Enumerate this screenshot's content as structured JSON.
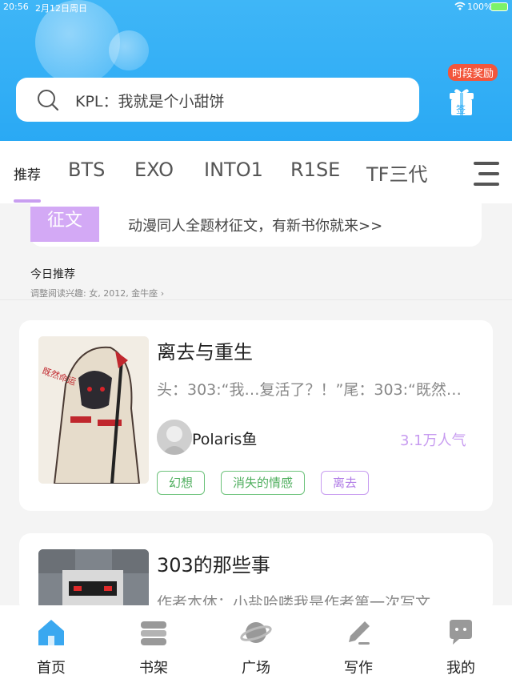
{
  "status_bar": {
    "time": "20:56",
    "date": "2月12日周日",
    "battery": "100%"
  },
  "search": {
    "placeholder": "KPL：我就是个小甜饼"
  },
  "reward": {
    "badge": "时段奖励",
    "box_label": "签"
  },
  "tabs": [
    {
      "label": "推荐",
      "active": true
    },
    {
      "label": "BTS"
    },
    {
      "label": "EXO"
    },
    {
      "label": "INTO1"
    },
    {
      "label": "R1SE"
    },
    {
      "label": "TF三代"
    }
  ],
  "banner": {
    "tag": "征文",
    "text": "动漫同人全题材征文，有新书你就来>>"
  },
  "recommendation": {
    "title": "今日推荐",
    "subtitle": "调整阅读兴趣: 女, 2012, 金牛座",
    "chevron": "›"
  },
  "books": [
    {
      "title": "离去与重生",
      "description": "头：303:“我…复活了？！”尾：303:“既然…",
      "author": "Polaris鱼",
      "popularity": "3.1万人气",
      "tags": [
        {
          "label": "幻想",
          "style": "green"
        },
        {
          "label": "消失的情感",
          "style": "green"
        },
        {
          "label": "离去",
          "style": "purple"
        }
      ]
    },
    {
      "title": "303的那些事",
      "description": "作者本体：小盐哈喽我是作者第一次写文…"
    }
  ],
  "bottom_nav": [
    {
      "label": "首页",
      "icon": "home-icon",
      "active": true
    },
    {
      "label": "书架",
      "icon": "bookshelf-icon"
    },
    {
      "label": "广场",
      "icon": "planet-icon"
    },
    {
      "label": "写作",
      "icon": "pen-icon"
    },
    {
      "label": "我的",
      "icon": "chat-bubble-icon"
    }
  ],
  "colors": {
    "header": "#2aa9f4",
    "accent_purple": "#c79bf0",
    "tag_green": "#4fae5e",
    "home_blue": "#3aa8f0"
  }
}
